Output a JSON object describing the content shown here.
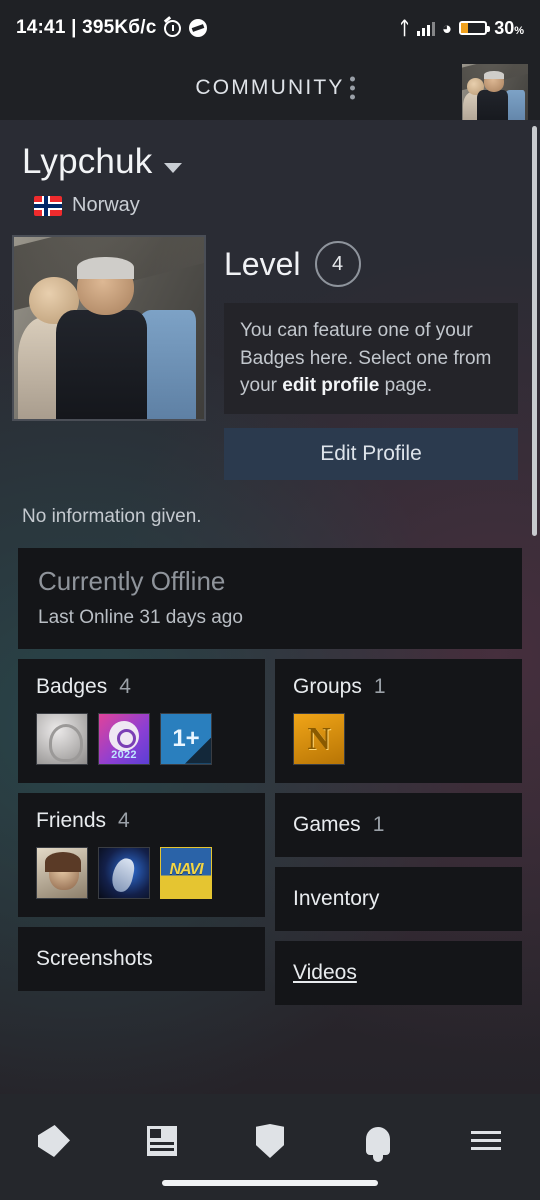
{
  "status_bar": {
    "clock": "14:41 | 395Kб/c",
    "alarm_icon": "alarm-icon",
    "mute_icon": "mute-icon",
    "bluetooth_icon": "bluetooth-icon",
    "signal_icon": "signal-icon",
    "wifi_icon": "wifi-icon",
    "battery_icon": "battery-icon",
    "battery_percent": "30",
    "battery_unit": "%",
    "battery_level_pct": 30,
    "battery_color": "#f0a11e"
  },
  "app_bar": {
    "title": "COMMUNITY",
    "overflow_icon": "kebab-menu-icon",
    "avatar_icon": "user-avatar-photo"
  },
  "profile": {
    "persona_name": "Lypchuk",
    "dropdown_icon": "chevron-down-icon",
    "country": "Norway",
    "flag_icon": "norway-flag-icon",
    "avatar_icon": "profile-avatar-photo",
    "level_label": "Level",
    "level_value": "4",
    "badge_hint_prefix": "You can feature one of your Badges here. Select one from your ",
    "badge_hint_link": "edit profile",
    "badge_hint_suffix": " page.",
    "edit_profile_label": "Edit Profile",
    "summary_text": "No information given."
  },
  "status_card": {
    "state": "Currently Offline",
    "last_online": "Last Online 31 days ago"
  },
  "tiles": {
    "badges": {
      "title": "Badges",
      "count": "4",
      "items": [
        {
          "name": "badge-foil-coin",
          "label": ""
        },
        {
          "name": "badge-steam-2022",
          "label": "2022"
        },
        {
          "name": "badge-one-plus",
          "label": "1+"
        }
      ]
    },
    "groups": {
      "title": "Groups",
      "count": "1",
      "items": [
        {
          "name": "group-avatar-n",
          "label": "N"
        }
      ]
    },
    "friends": {
      "title": "Friends",
      "count": "4",
      "items": [
        {
          "name": "friend-avatar-portrait",
          "label": ""
        },
        {
          "name": "friend-avatar-blue-art",
          "label": ""
        },
        {
          "name": "friend-avatar-navi",
          "label": "NAVI"
        }
      ]
    },
    "games": {
      "title": "Games",
      "count": "1"
    },
    "inventory": {
      "title": "Inventory",
      "count": ""
    },
    "screenshots": {
      "title": "Screenshots",
      "count": ""
    },
    "videos": {
      "title": "Videos",
      "count": ""
    }
  },
  "bottom_nav": {
    "items": [
      {
        "name": "nav-store",
        "icon": "tag-icon"
      },
      {
        "name": "nav-news",
        "icon": "news-icon"
      },
      {
        "name": "nav-guard",
        "icon": "shield-icon"
      },
      {
        "name": "nav-notifications",
        "icon": "bell-icon"
      },
      {
        "name": "nav-menu",
        "icon": "hamburger-menu-icon"
      }
    ]
  },
  "colors": {
    "accent_button": "#2b3a4e",
    "card_bg": "#141518",
    "chrome_bg": "#1f2125"
  }
}
